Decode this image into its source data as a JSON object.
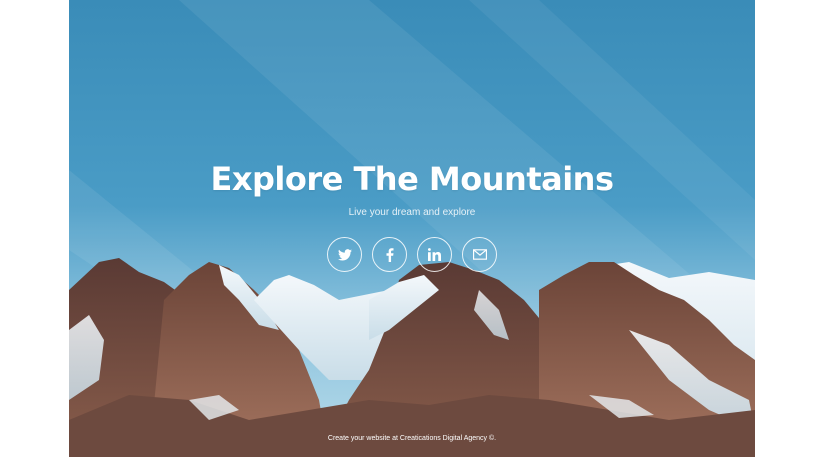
{
  "hero": {
    "title": "Explore The Mountains",
    "subtitle": "Live your dream and explore"
  },
  "social": [
    {
      "name": "twitter",
      "icon": "twitter-icon"
    },
    {
      "name": "facebook",
      "icon": "facebook-icon"
    },
    {
      "name": "linkedin",
      "icon": "linkedin-icon"
    },
    {
      "name": "email",
      "icon": "envelope-icon"
    }
  ],
  "footer": {
    "credit": "Create your website at Creatications Digital Agency ©."
  },
  "colors": {
    "sky_top": "#3a8cb8",
    "sky_bottom": "#b9dcea",
    "text": "#ffffff"
  }
}
